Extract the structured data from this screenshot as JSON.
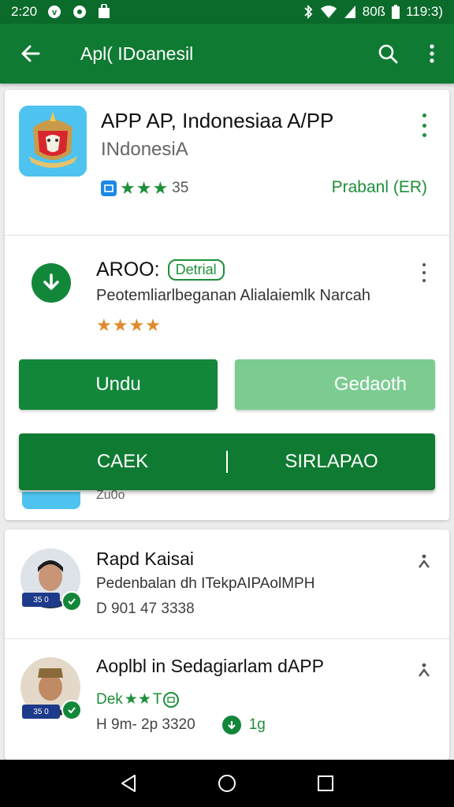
{
  "status_bar": {
    "time_left": "2:20",
    "battery_text": "80ß",
    "time_right": "119:3)"
  },
  "app_bar": {
    "title": "Apl( IDoanesil"
  },
  "app": {
    "name": "APP AP, Indonesiaa A/PP",
    "developer": "INdonesiA",
    "rating_text": "35",
    "stars": "★★★",
    "price": "Prabanl (ER)"
  },
  "section": {
    "title": "AROO:",
    "tag": "Detrial",
    "description": "Peotemliarlbeganan Alialaiemlk Narcah",
    "stars": "★★★★"
  },
  "buttons": {
    "undu": "Undu",
    "gedaoth": "Gedaoth",
    "caek": "CAEK",
    "sirlapao": "SIRLAPAO"
  },
  "peek": {
    "text": "Zu0o"
  },
  "list": [
    {
      "title": "Rapd Kaisai",
      "subtitle": "Pedenbalan dh ITekpAIPAolMPH",
      "meta": "D 901  47 3338",
      "tag": "35 0"
    },
    {
      "title": "Aoplbl in Sedagiarlam dAPP",
      "rating_prefix": "Dek",
      "stars": "★★",
      "rating_suffix": "T",
      "meta": "H 9m- 2p 3320",
      "size": "1g",
      "tag": "35 0"
    }
  ],
  "colors": {
    "primary": "#0f7a32",
    "status_bar": "#0b6b2b",
    "accent_green": "#1e8f3a",
    "light_green": "#7ccc92",
    "star_orange": "#e08a28"
  }
}
